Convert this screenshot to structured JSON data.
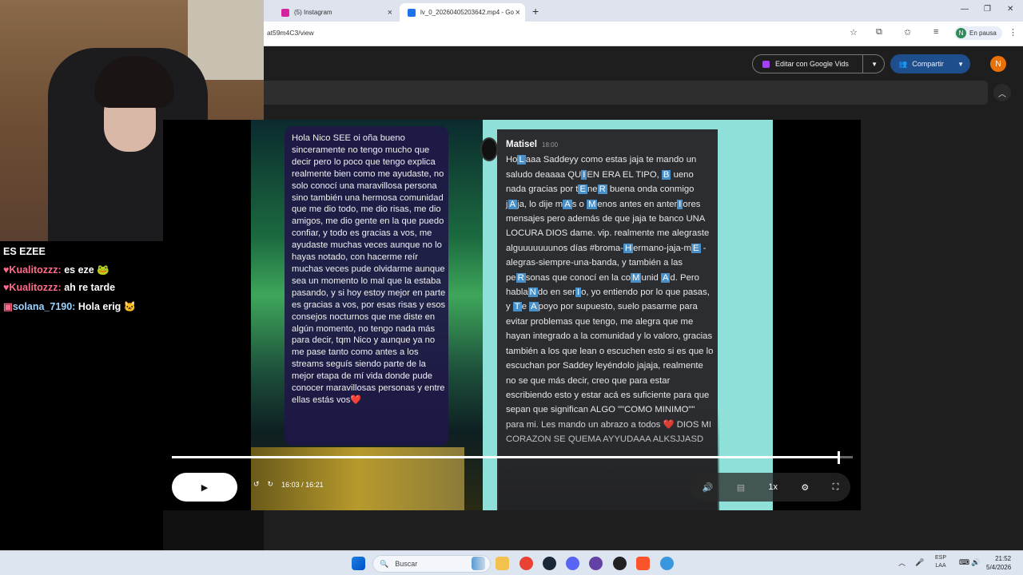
{
  "browser": {
    "tabs": [
      {
        "label": "(5) Instagram",
        "favicon_color": "#d6249f"
      },
      {
        "label": "lv_0_20260405203642.mp4 - Go",
        "favicon_color": "#1a73e8"
      }
    ],
    "url": "at59m4C3/view",
    "profile_initial": "N",
    "profile_status": "En pausa"
  },
  "drive": {
    "edit_label": "Editar con Google Vids",
    "share_label": "Compartir",
    "avatar_initial": "N"
  },
  "video": {
    "bubble_text": "Hola Nico SEE oi oña bueno sinceramente no tengo mucho que decir pero lo poco que tengo explica realmente bien como me ayudaste, no solo conocí una maravillosa persona sino también una hermosa comunidad que me dio todo, me dio risas, me dio amigos, me dio gente en la que puedo confiar, y todo es gracias a vos, me ayudaste muchas veces aunque no lo hayas notado, con hacerme reír muchas veces pude olvidarme aunque sea un momento lo mal que la estaba pasando, y si hoy estoy mejor en parte es gracias a vos, por esas risas y esos consejos nocturnos que me diste en algún momento, no tengo nada más para decir, tqm Nico y aunque ya no me pase tanto como antes a los streams seguís siendo parte de la mejor etapa de mí vida donde pude conocer maravillosas personas y entre ellas estás vos❤️",
    "discord_name": "Matisel",
    "discord_time": "18:00",
    "time_current": "16:03",
    "time_total": "16:21",
    "progress_fraction": 0.978,
    "speed": "1x"
  },
  "stream_chat": {
    "title": "ES EZEE",
    "messages": [
      {
        "user": "Kualitozzz:",
        "text": "es eze 🐸",
        "badge": "♥"
      },
      {
        "user": "Kualitozzz:",
        "text": "ah re tarde",
        "badge": "♥"
      },
      {
        "user": "solana_7190:",
        "text": "Hola erig 🐱",
        "badge": "▣"
      }
    ]
  },
  "taskbar": {
    "search_placeholder": "Buscar",
    "lang_line1": "ESP",
    "lang_line2": "LAA",
    "time": "21:52",
    "date": "5/4/2026"
  }
}
